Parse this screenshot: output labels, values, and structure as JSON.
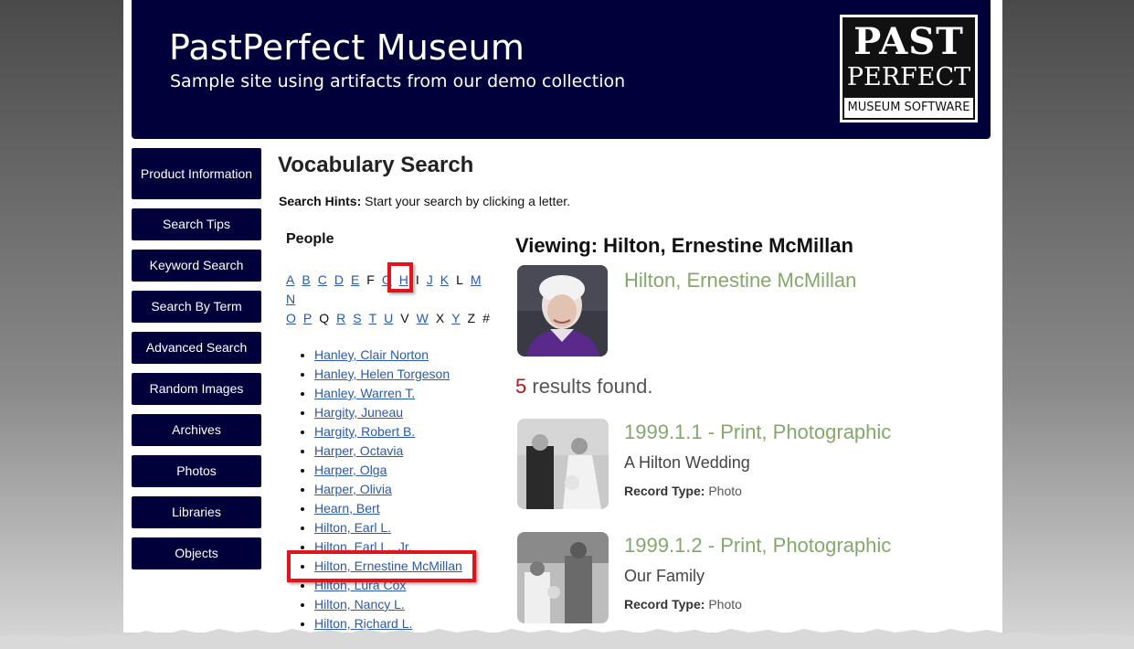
{
  "header": {
    "title": "PastPerfect Museum",
    "subtitle": "Sample site using artifacts from our demo collection",
    "logo": {
      "line1": "PAST",
      "line2": "PERFECT",
      "line3": "MUSEUM SOFTWARE"
    }
  },
  "nav": [
    "Product Information",
    "Search Tips",
    "Keyword Search",
    "Search By Term",
    "Advanced Search",
    "Random Images",
    "Archives",
    "Photos",
    "Libraries",
    "Objects"
  ],
  "main": {
    "title": "Vocabulary Search",
    "hints_label": "Search Hints:",
    "hints_text": " Start your search by clicking a letter."
  },
  "people": {
    "heading": "People",
    "letters": [
      {
        "l": "A",
        "link": true
      },
      {
        "l": "B",
        "link": true
      },
      {
        "l": "C",
        "link": true
      },
      {
        "l": "D",
        "link": true
      },
      {
        "l": "E",
        "link": true
      },
      {
        "l": "F",
        "link": false
      },
      {
        "l": "G",
        "link": true
      },
      {
        "l": "H",
        "link": true
      },
      {
        "l": "I",
        "link": false
      },
      {
        "l": "J",
        "link": true
      },
      {
        "l": "K",
        "link": true
      },
      {
        "l": "L",
        "link": false
      },
      {
        "l": "M",
        "link": true
      },
      {
        "l": "N",
        "link": true
      },
      {
        "l": "O",
        "link": true
      },
      {
        "l": "P",
        "link": true
      },
      {
        "l": "Q",
        "link": false
      },
      {
        "l": "R",
        "link": true
      },
      {
        "l": "S",
        "link": true
      },
      {
        "l": "T",
        "link": true
      },
      {
        "l": "U",
        "link": true
      },
      {
        "l": "V",
        "link": false
      },
      {
        "l": "W",
        "link": true
      },
      {
        "l": "X",
        "link": false
      },
      {
        "l": "Y",
        "link": true
      },
      {
        "l": "Z",
        "link": false
      },
      {
        "l": "#",
        "link": false
      }
    ],
    "selected_letter": "H",
    "names": [
      "Hanley, Clair Norton",
      "Hanley, Helen Torgeson",
      "Hanley, Warren T.",
      "Hargity, Juneau",
      "Hargity, Robert B.",
      "Harper, Octavia",
      "Harper, Olga",
      "Harper, Olivia",
      "Hearn, Bert",
      "Hilton, Earl L.",
      "Hilton, Earl L., Jr.",
      "Hilton, Ernestine McMillan",
      "Hilton, Lura Cox",
      "Hilton, Nancy L.",
      "Hilton, Richard L."
    ],
    "selected_name": "Hilton, Ernestine McMillan"
  },
  "viewing": {
    "label": "Viewing: Hilton, Ernestine McMillan",
    "person_name": "Hilton, Ernestine McMillan",
    "results_count": "5",
    "results_text": " results found.",
    "records": [
      {
        "title": "1999.1.1 - Print, Photographic",
        "subtitle": "A Hilton Wedding",
        "type_label": "Record Type:",
        "type_value": " Photo"
      },
      {
        "title": "1999.1.2 - Print, Photographic",
        "subtitle": "Our Family",
        "type_label": "Record Type:",
        "type_value": " Photo"
      }
    ]
  },
  "colors": {
    "header_bg": "#00003a",
    "link": "#2a5aa8",
    "record_title": "#84a86a",
    "highlight_box": "#e2131b",
    "results_count": "#b01818"
  }
}
